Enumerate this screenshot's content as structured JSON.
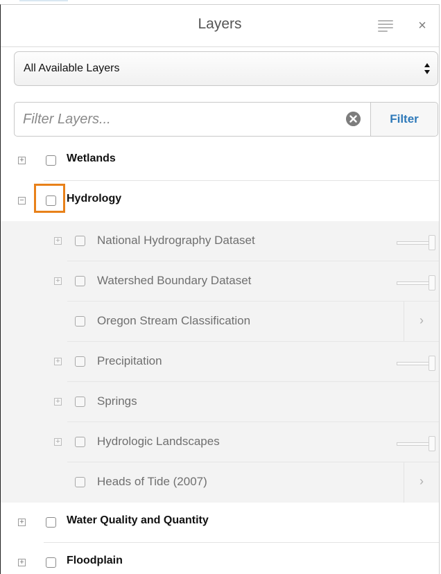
{
  "header": {
    "title": "Layers",
    "menu_icon": "list-icon",
    "close_icon": "close-icon",
    "close_symbol": "×"
  },
  "layer_select": {
    "value": "All Available Layers"
  },
  "filter": {
    "placeholder": "Filter Layers...",
    "button_label": "Filter"
  },
  "tree": {
    "wetlands": {
      "label": "Wetlands",
      "expander": "+"
    },
    "hydrology": {
      "label": "Hydrology",
      "expander": "−",
      "children": [
        {
          "label": "National Hydrography Dataset",
          "expander": "+"
        },
        {
          "label": "Watershed Boundary Dataset",
          "expander": "+"
        },
        {
          "label": "Oregon Stream Classification",
          "chevron": "›"
        },
        {
          "label": "Precipitation",
          "expander": "+"
        },
        {
          "label": "Springs",
          "expander": "+"
        },
        {
          "label": "Hydrologic Landscapes",
          "expander": "+"
        },
        {
          "label": "Heads of Tide (2007)",
          "chevron": "›"
        }
      ]
    },
    "water_quality": {
      "label": "Water Quality and Quantity",
      "expander": "+"
    },
    "floodplain": {
      "label": "Floodplain",
      "expander": "+"
    }
  },
  "colors": {
    "accent": "#2e79b9",
    "highlight": "#e8811a"
  }
}
